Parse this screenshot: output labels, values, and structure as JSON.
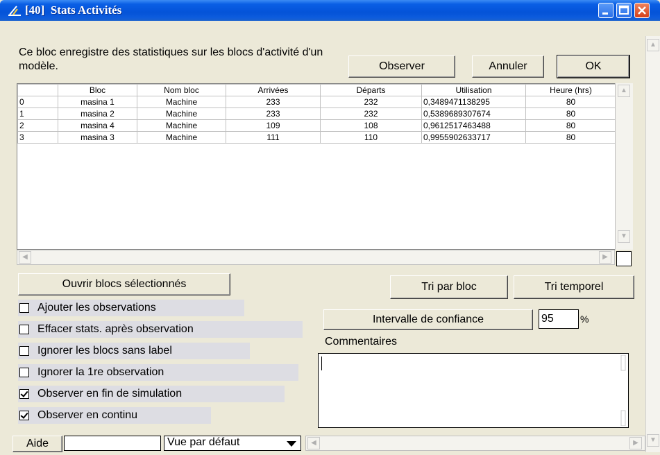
{
  "window": {
    "title": "[40]  Stats Activités",
    "title_color": "#0453D8"
  },
  "description": "Ce bloc enregistre des statistiques sur les blocs d'activité d'un modèle.",
  "buttons": {
    "observe": "Observer",
    "cancel": "Annuler",
    "ok": "OK",
    "open_selected": "Ouvrir blocs sélectionnés",
    "sort_block": "Tri par bloc",
    "sort_time": "Tri temporel",
    "confidence": "Intervalle de confiance",
    "help": "Aide"
  },
  "table": {
    "columns": [
      "",
      "Bloc",
      "Nom bloc",
      "Arrivées",
      "Départs",
      "Utilisation",
      "Heure (hrs)"
    ],
    "rows": [
      [
        "0",
        "masina 1",
        "Machine",
        "233",
        "232",
        "0,3489471138295",
        "80"
      ],
      [
        "1",
        "masina 2",
        "Machine",
        "233",
        "232",
        "0,5389689307674",
        "80"
      ],
      [
        "2",
        "masina 4",
        "Machine",
        "109",
        "108",
        "0,9612517463488",
        "80"
      ],
      [
        "3",
        "masina 3",
        "Machine",
        "111",
        "110",
        "0,9955902633717",
        "80"
      ]
    ]
  },
  "options": [
    {
      "label": "Ajouter les observations",
      "checked": false
    },
    {
      "label": "Effacer stats. après observation",
      "checked": false
    },
    {
      "label": "Ignorer les blocs sans label",
      "checked": false
    },
    {
      "label": "Ignorer la 1re observation",
      "checked": false
    },
    {
      "label": "Observer en fin de simulation",
      "checked": true
    },
    {
      "label": "Observer en continu",
      "checked": true
    }
  ],
  "confidence": {
    "value": "95",
    "unit": "%"
  },
  "comments": {
    "label": "Commentaires",
    "value": ""
  },
  "status": {
    "field_value": "",
    "view_select": "Vue par défaut"
  }
}
